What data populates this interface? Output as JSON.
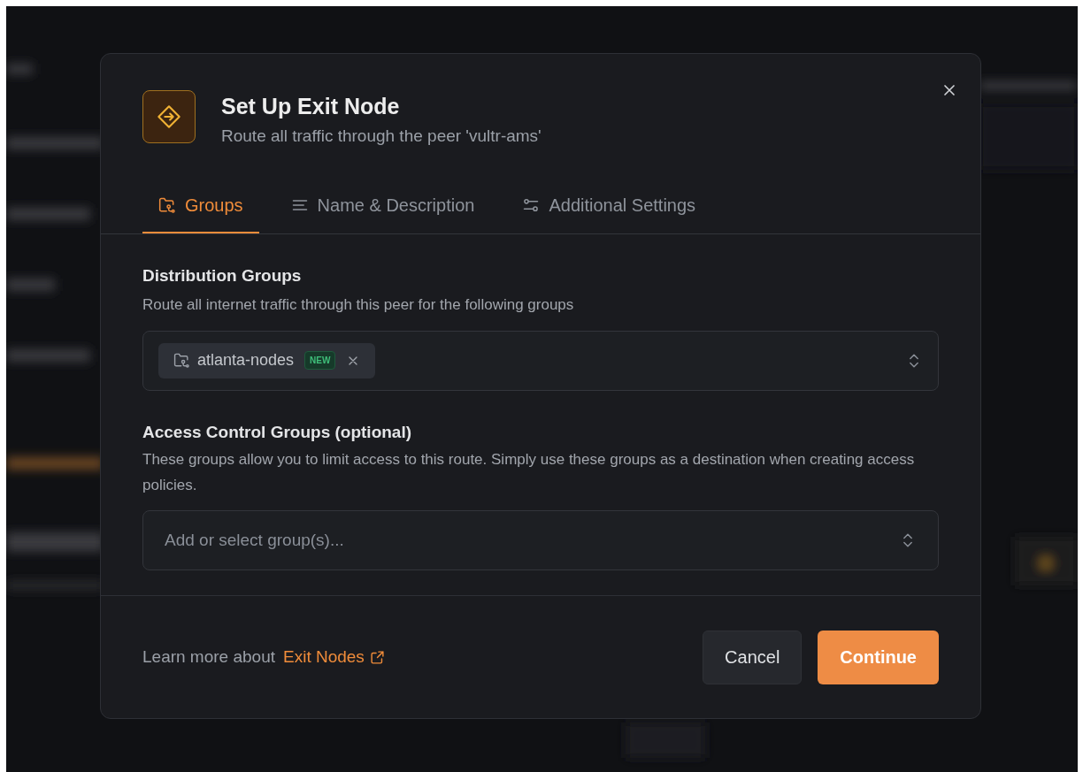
{
  "dialog": {
    "title": "Set Up Exit Node",
    "subtitle": "Route all traffic through the peer 'vultr-ams'"
  },
  "tabs": [
    {
      "label": "Groups",
      "kind": "groups",
      "selected": true
    },
    {
      "label": "Name & Description",
      "kind": "text",
      "selected": false
    },
    {
      "label": "Additional Settings",
      "kind": "settings",
      "selected": false
    }
  ],
  "distribution_groups": {
    "label": "Distribution Groups",
    "help": "Route all internet traffic through this peer for the following groups",
    "chips": [
      {
        "name": "atlanta-nodes",
        "badge": "NEW"
      }
    ]
  },
  "access_control_groups": {
    "label": "Access Control Groups (optional)",
    "help": "These groups allow you to limit access to this route. Simply use these groups as a destination when creating access policies.",
    "placeholder": "Add or select group(s)..."
  },
  "footer": {
    "text": "Learn more about",
    "link": "Exit Nodes",
    "buttons": [
      {
        "label": "Cancel",
        "kind": "secondary"
      },
      {
        "label": "Continue",
        "kind": "primary"
      }
    ]
  }
}
